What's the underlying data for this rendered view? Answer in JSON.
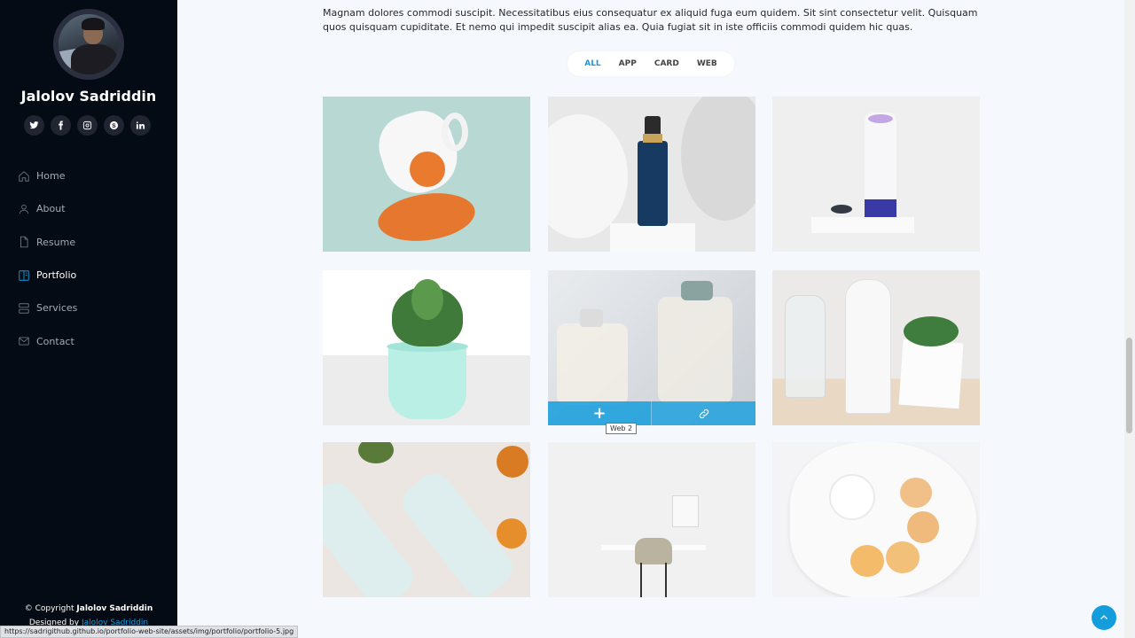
{
  "profile": {
    "name": "Jalolov Sadriddin",
    "socials": [
      {
        "icon": "twitter-icon"
      },
      {
        "icon": "facebook-icon"
      },
      {
        "icon": "instagram-icon"
      },
      {
        "icon": "skype-icon"
      },
      {
        "icon": "linkedin-icon"
      }
    ]
  },
  "nav": {
    "items": [
      {
        "label": "Home",
        "icon": "home-icon"
      },
      {
        "label": "About",
        "icon": "person-icon"
      },
      {
        "label": "Resume",
        "icon": "file-icon"
      },
      {
        "label": "Portfolio",
        "icon": "book-icon",
        "active": true
      },
      {
        "label": "Services",
        "icon": "server-icon"
      },
      {
        "label": "Contact",
        "icon": "envelope-icon"
      }
    ]
  },
  "footer": {
    "copyright_prefix": "© Copyright ",
    "copyright_name": "Jalolov Sadriddin",
    "designed_prefix": "Designed by ",
    "designed_name": "Jalolov Sadriddin"
  },
  "portfolio": {
    "intro": "Magnam dolores commodi suscipit. Necessitatibus eius consequatur ex aliquid fuga eum quidem. Sit sint consectetur velit. Quisquam quos quisquam cupiditate. Et nemo qui impedit suscipit alias ea. Quia fugiat sit in iste officiis commodi quidem hic quas.",
    "filters": [
      "ALL",
      "APP",
      "CARD",
      "WEB"
    ],
    "active_filter": "ALL",
    "hover_item": {
      "tooltip": "Web 2",
      "plus_label": "+"
    }
  },
  "status_bar": {
    "url": "https://sadrigithub.github.io/portfolio-web-site/assets/img/portfolio/portfolio-5.jpg"
  },
  "colors": {
    "accent": "#149ddd",
    "sidebar_bg": "#040b14",
    "page_bg": "#f5f8fd"
  }
}
